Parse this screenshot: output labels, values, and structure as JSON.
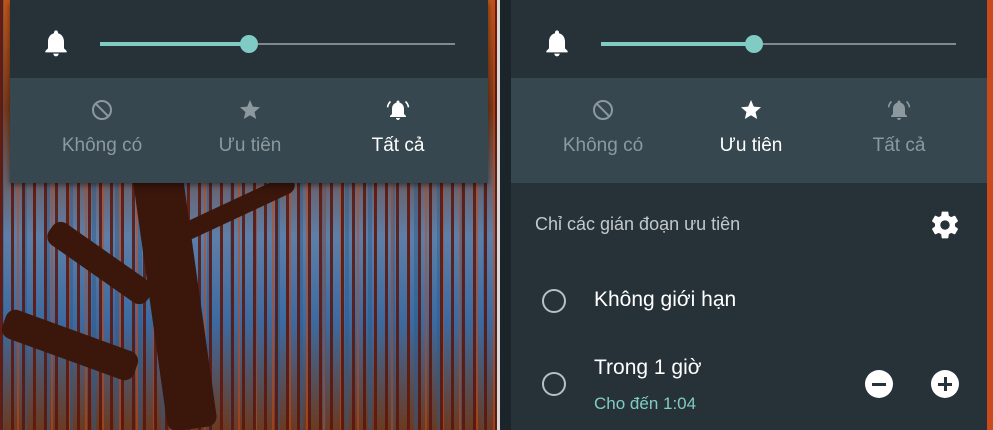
{
  "left_panel": {
    "volume_fraction": 0.42,
    "modes": [
      {
        "label": "Không có",
        "icon": "block-icon",
        "active": false
      },
      {
        "label": "Ưu tiên",
        "icon": "star-icon",
        "active": false
      },
      {
        "label": "Tất cả",
        "icon": "ringing-bell-icon",
        "active": true
      }
    ]
  },
  "right_panel": {
    "volume_fraction": 0.43,
    "modes": [
      {
        "label": "Không có",
        "icon": "block-icon",
        "active": false
      },
      {
        "label": "Ưu tiên",
        "icon": "star-icon",
        "active": true
      },
      {
        "label": "Tất cả",
        "icon": "ringing-bell-icon",
        "active": false
      }
    ],
    "section_title": "Chỉ các gián đoạn ưu tiên",
    "options": [
      {
        "label": "Không giới hạn",
        "selected": true
      },
      {
        "label": "Trong 1 giờ",
        "sublabel": "Cho đến 1:04",
        "selected": false
      }
    ]
  },
  "colors": {
    "accent": "#80cbc4",
    "panel": "#263238",
    "mode_bar": "#37474f"
  }
}
